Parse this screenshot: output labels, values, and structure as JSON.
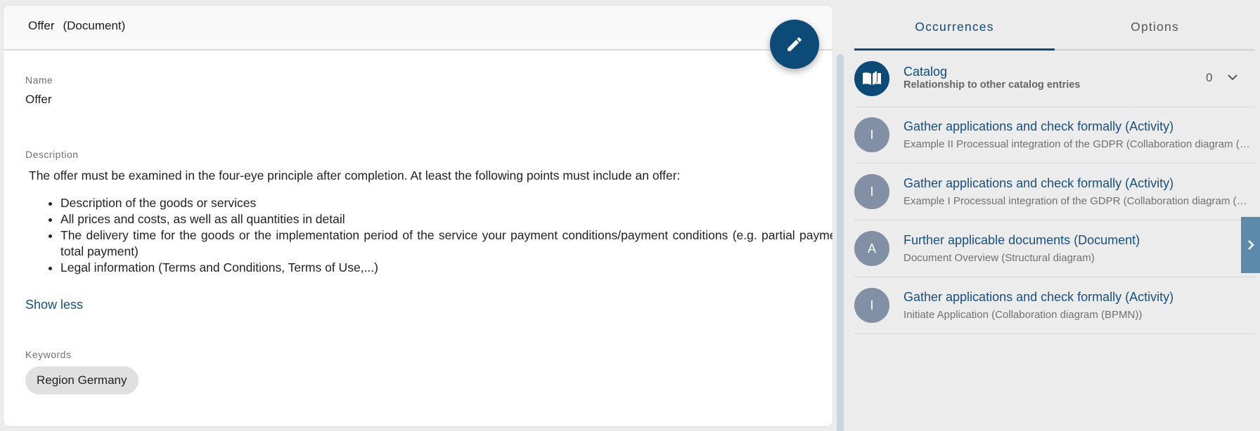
{
  "detail": {
    "title": "Offer",
    "type_label": "(Document)",
    "fields": {
      "name_label": "Name",
      "name_value": "Offer",
      "description_label": "Description",
      "description_intro": "The offer must be examined in the four-eye principle after completion. At least the following points must include an offer:",
      "description_points": [
        "Description of the goods or services",
        "All prices and costs, as well as all quantities in detail",
        "The delivery time for the goods or the implementation period of the service your payment conditions/payment conditions (e.g. partial payment, total payment)",
        "Legal information (Terms and Conditions, Terms of Use,...)"
      ],
      "show_less_label": "Show less",
      "keywords_label": "Keywords",
      "keywords": [
        "Region Germany"
      ]
    },
    "edit_icon": "pencil-icon"
  },
  "panel": {
    "tabs": [
      {
        "label": "Occurrences",
        "active": true
      },
      {
        "label": "Options",
        "active": false
      }
    ],
    "catalog": {
      "title": "Catalog",
      "subtitle": "Relationship to other catalog entries",
      "count": "0",
      "icon": "book-open-icon"
    },
    "occurrences": [
      {
        "avatar": "I",
        "title": "Gather applications and check formally (Activity)",
        "subtitle": "Example II Processual integration of the GDPR (Collaboration diagram (BPMN))"
      },
      {
        "avatar": "I",
        "title": "Gather applications and check formally (Activity)",
        "subtitle": "Example I Processual integration of the GDPR (Collaboration diagram (BPMN))"
      },
      {
        "avatar": "A",
        "title": "Further applicable documents (Document)",
        "subtitle": "Document Overview (Structural diagram)"
      },
      {
        "avatar": "I",
        "title": "Gather applications and check formally (Activity)",
        "subtitle": "Initiate Application (Collaboration diagram (BPMN))"
      }
    ],
    "collapse_icon": "chevron-right-icon"
  },
  "colors": {
    "primary": "#0c4a78",
    "link": "#17507e",
    "avatar": "#8190a4",
    "collapse_tab": "#5b8aab",
    "background": "#ececec"
  }
}
